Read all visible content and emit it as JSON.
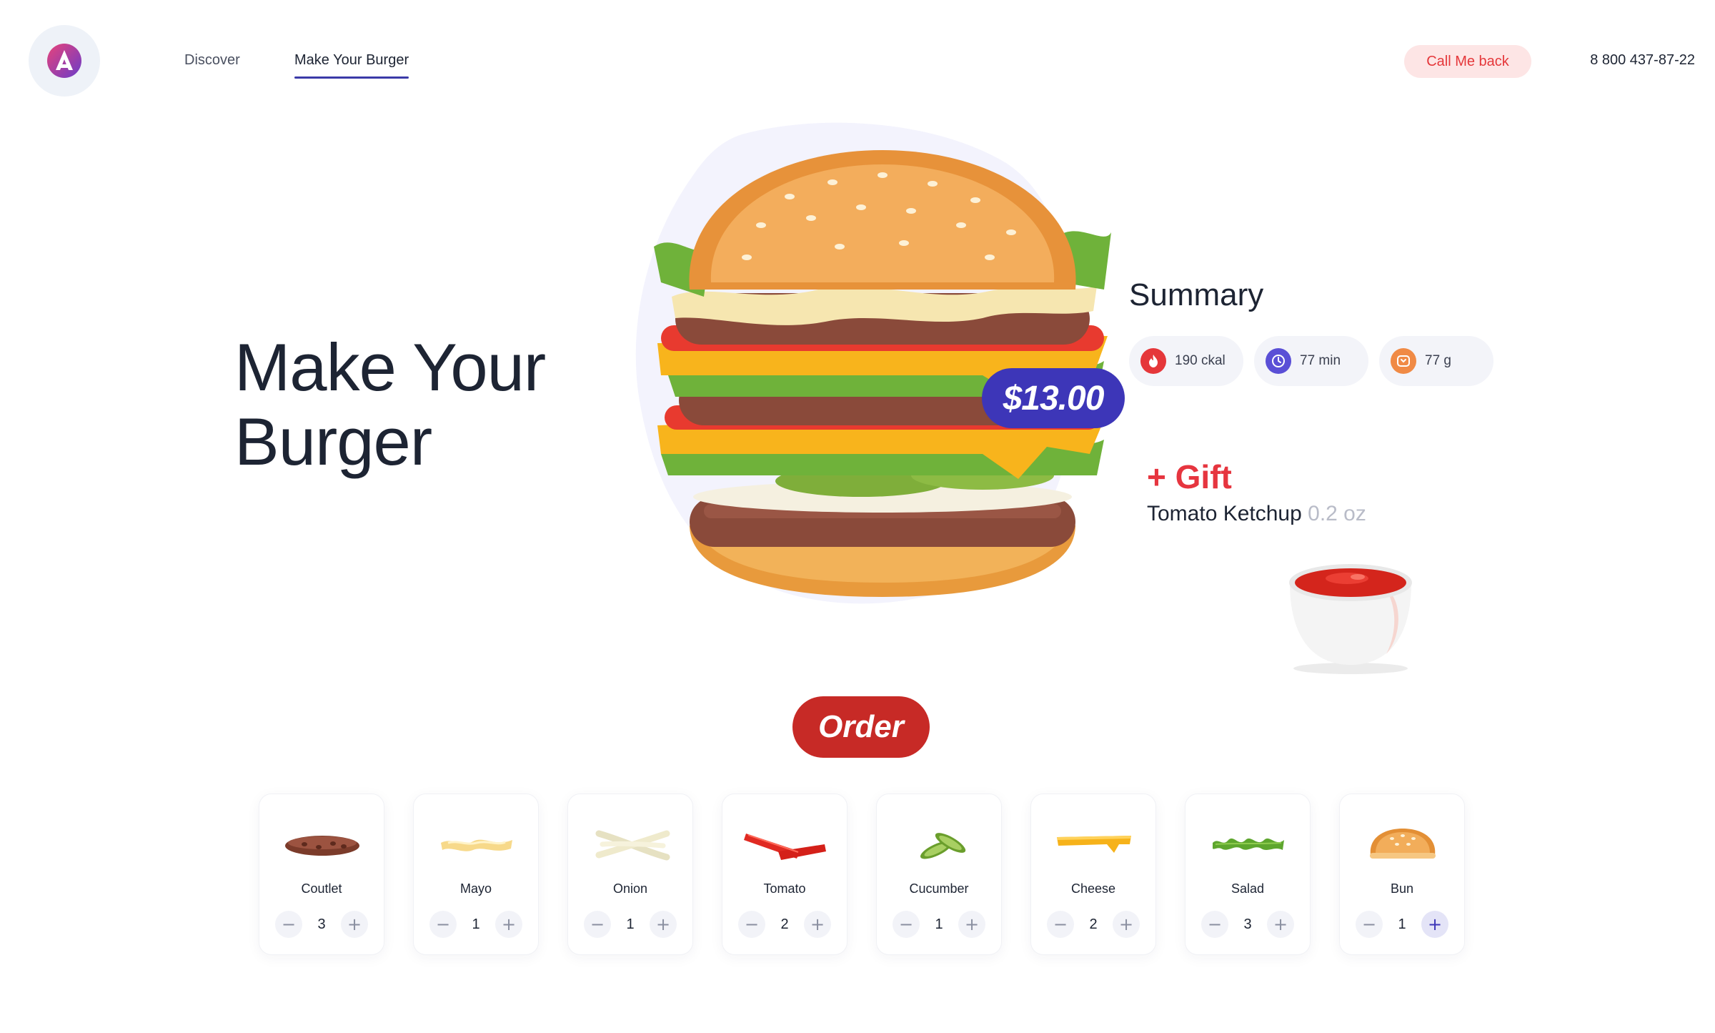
{
  "header": {
    "nav": [
      {
        "label": "Discover"
      },
      {
        "label": "Make Your Burger"
      }
    ],
    "callback_label": "Call Me back",
    "phone": "8 800 437-87-22"
  },
  "hero": {
    "title_line1": "Make Your",
    "title_line2": "Burger",
    "price": "$13.00"
  },
  "summary": {
    "title": "Summary",
    "stats": [
      {
        "icon": "flame-icon",
        "value": "190",
        "unit": "ckal",
        "color": "#e5373a"
      },
      {
        "icon": "clock-icon",
        "value": "77",
        "unit": "min",
        "color": "#5a4fd6"
      },
      {
        "icon": "weight-icon",
        "value": "77",
        "unit": "g",
        "color": "#f08a45"
      }
    ]
  },
  "gift": {
    "title": "+ Gift",
    "item": "Tomato Ketchup",
    "amount": "0.2 oz"
  },
  "order_label": "Order",
  "ingredients": [
    {
      "name": "Coutlet",
      "qty": "3"
    },
    {
      "name": "Mayo",
      "qty": "1"
    },
    {
      "name": "Onion",
      "qty": "1"
    },
    {
      "name": "Tomato",
      "qty": "2"
    },
    {
      "name": "Cucumber",
      "qty": "1"
    },
    {
      "name": "Cheese",
      "qty": "2"
    },
    {
      "name": "Salad",
      "qty": "3"
    },
    {
      "name": "Bun",
      "qty": "1"
    }
  ],
  "colors": {
    "accent": "#3d36b8",
    "order": "#c72a26",
    "gift": "#e6353f",
    "callback_bg": "#fde5e5"
  }
}
